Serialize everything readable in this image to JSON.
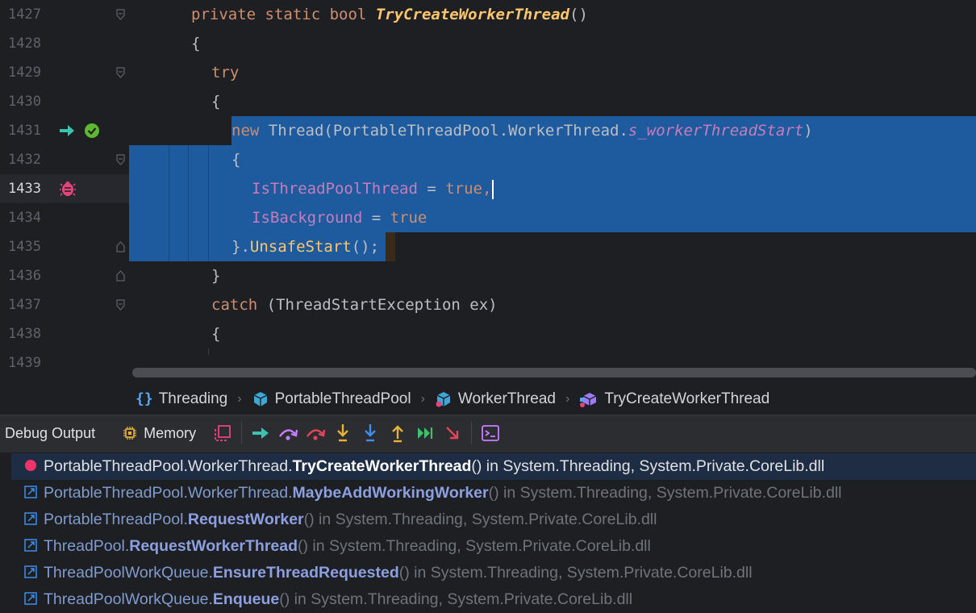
{
  "editor": {
    "line_numbers": [
      "1427",
      "1428",
      "1429",
      "1430",
      "1431",
      "1432",
      "1433",
      "1434",
      "1435",
      "1436",
      "1437",
      "1438",
      "1439"
    ],
    "current_line": "1433",
    "code": {
      "l1427_kw": "private static bool ",
      "l1427_fn": "TryCreateWorkerThread",
      "l1427_end": "()",
      "l1428": "{",
      "l1429": "try",
      "l1430": "{",
      "l1431_kw": "new",
      "l1431_a": " Thread(PortableThreadPool.WorkerThread.",
      "l1431_field": "s_workerThreadStart",
      "l1431_end": ")",
      "l1432": "{",
      "l1433_prop": "IsThreadPoolThread",
      "l1433_eq": " = ",
      "l1433_val": "true,",
      "l1434_prop": "IsBackground",
      "l1434_eq": " = ",
      "l1434_val": "true",
      "l1435_a": "}.",
      "l1435_fn": "UnsafeStart",
      "l1435_end": "();",
      "l1436": "}",
      "l1437_kw": "catch",
      "l1437_rest": " (ThreadStartException ex)",
      "l1438": "{"
    }
  },
  "breadcrumb": {
    "namespace": "Threading",
    "class": "PortableThreadPool",
    "nested": "WorkerThread",
    "method": "TryCreateWorkerThread"
  },
  "toolbar": {
    "tab_output": "Debug Output",
    "tab_memory": "Memory"
  },
  "frames": [
    {
      "cls": "PortableThreadPool.WorkerThread.",
      "method": "TryCreateWorkerThread",
      "tail": "() in System.Threading, System.Private.CoreLib.dll"
    },
    {
      "cls": "PortableThreadPool.WorkerThread.",
      "method": "MaybeAddWorkingWorker",
      "tail": "() in System.Threading, System.Private.CoreLib.dll"
    },
    {
      "cls": "PortableThreadPool.",
      "method": "RequestWorker",
      "tail": "() in System.Threading, System.Private.CoreLib.dll"
    },
    {
      "cls": "ThreadPool.",
      "method": "RequestWorkerThread",
      "tail": "() in System.Threading, System.Private.CoreLib.dll"
    },
    {
      "cls": "ThreadPoolWorkQueue.",
      "method": "EnsureThreadRequested",
      "tail": "() in System.Threading, System.Private.CoreLib.dll"
    },
    {
      "cls": "ThreadPoolWorkQueue.",
      "method": "Enqueue",
      "tail": "() in System.Threading, System.Private.CoreLib.dll"
    }
  ]
}
